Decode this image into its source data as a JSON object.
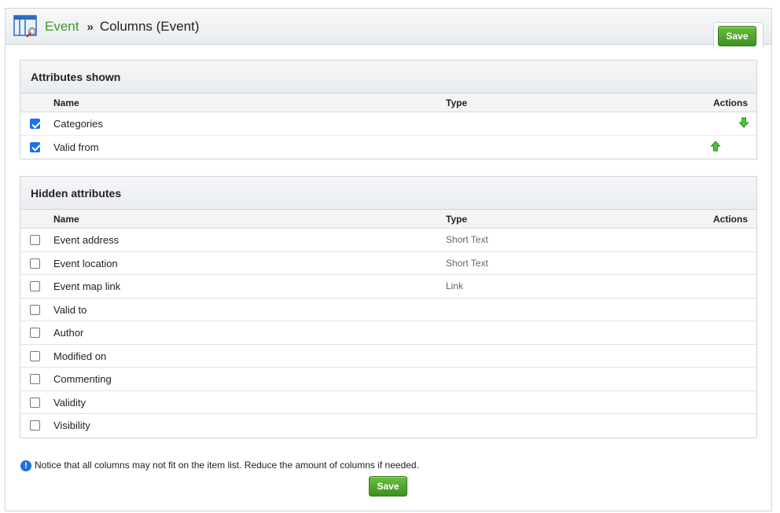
{
  "breadcrumb": {
    "parent": "Event",
    "separator": "»",
    "current": "Columns (Event)"
  },
  "buttons": {
    "save_top": "Save",
    "save_bottom": "Save"
  },
  "columns": {
    "name": "Name",
    "type": "Type",
    "actions": "Actions"
  },
  "shown": {
    "title": "Attributes shown",
    "rows": [
      {
        "name": "Categories",
        "type": "",
        "checked": true,
        "action": "move-down-icon"
      },
      {
        "name": "Valid from",
        "type": "",
        "checked": true,
        "action": "move-up-icon"
      }
    ]
  },
  "hidden": {
    "title": "Hidden attributes",
    "rows": [
      {
        "name": "Event address",
        "type": "Short Text",
        "checked": false
      },
      {
        "name": "Event location",
        "type": "Short Text",
        "checked": false
      },
      {
        "name": "Event map link",
        "type": "Link",
        "checked": false
      },
      {
        "name": "Valid to",
        "type": "",
        "checked": false
      },
      {
        "name": "Author",
        "type": "",
        "checked": false
      },
      {
        "name": "Modified on",
        "type": "",
        "checked": false
      },
      {
        "name": "Commenting",
        "type": "",
        "checked": false
      },
      {
        "name": "Validity",
        "type": "",
        "checked": false
      },
      {
        "name": "Visibility",
        "type": "",
        "checked": false
      }
    ]
  },
  "notice": {
    "icon": "info-icon",
    "text": "Notice that all columns may not fit on the item list. Reduce the amount of columns if needed."
  },
  "colors": {
    "accent_green": "#3a9a28",
    "button_green": "#4ea52b",
    "checkbox_blue": "#1a73e8",
    "info_blue": "#1e6fd9"
  }
}
